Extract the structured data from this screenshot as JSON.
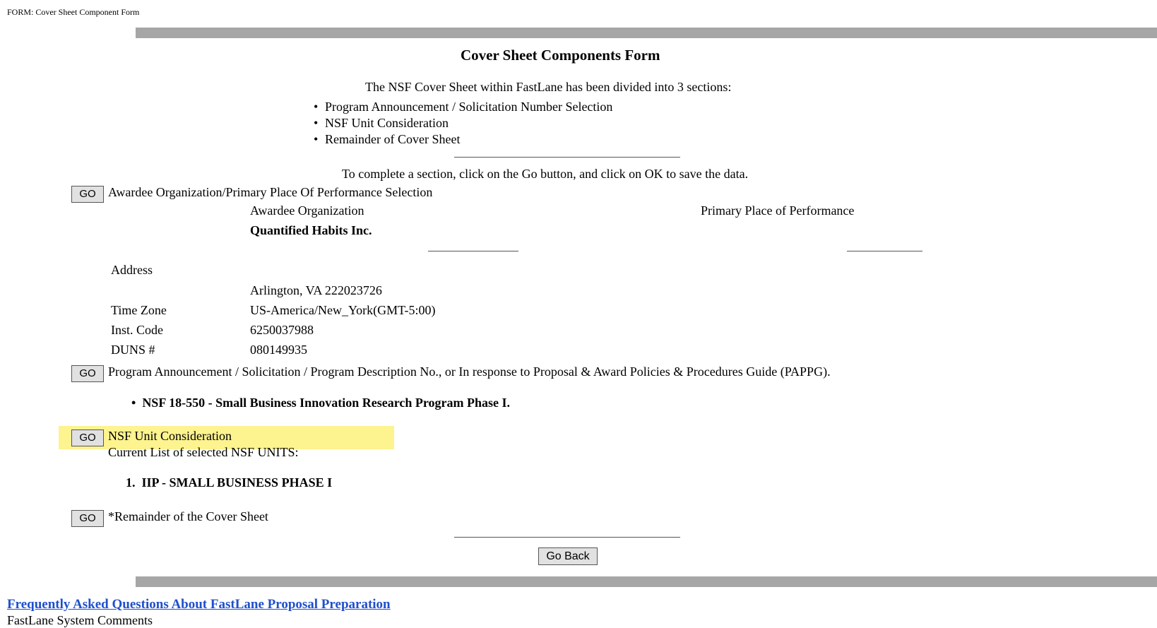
{
  "page": {
    "form_label": "FORM: Cover Sheet Component Form",
    "title": "Cover Sheet Components Form",
    "intro": "The NSF Cover Sheet within FastLane has been divided into 3 sections:",
    "sections": [
      "Program Announcement / Solicitation Number Selection",
      "NSF Unit Consideration",
      "Remainder of Cover Sheet"
    ],
    "instructions": "To complete a section, click on the Go button, and click on OK to save the data."
  },
  "go_label": "GO",
  "awardee": {
    "heading": "Awardee Organization/Primary Place Of Performance Selection",
    "org_label": "Awardee Organization",
    "ppop_label": "Primary Place of Performance",
    "org_name": "Quantified Habits Inc.",
    "address_label": "Address",
    "address_value": "Arlington, VA 222023726",
    "timezone_label": "Time Zone",
    "timezone_value": "US-America/New_York(GMT-5:00)",
    "inst_code_label": "Inst. Code",
    "inst_code_value": "6250037988",
    "duns_label": "DUNS #",
    "duns_value": "080149935"
  },
  "program": {
    "heading": "Program Announcement / Solicitation / Program Description No., or In response to Proposal & Award Policies & Procedures Guide (PAPPG).",
    "selected": "NSF 18-550 - Small Business Innovation Research Program Phase I."
  },
  "nsf_unit": {
    "heading": "NSF Unit Consideration",
    "list_label": "Current List of selected NSF UNITS:",
    "item_number": "1.",
    "item": "IIP - SMALL BUSINESS PHASE I"
  },
  "remainder": {
    "heading": "*Remainder of the Cover Sheet"
  },
  "go_back_label": "Go Back",
  "footer": {
    "faq_link": "Frequently Asked Questions About FastLane Proposal Preparation",
    "comments": "FastLane System Comments"
  },
  "colors": {
    "bar": "#a6a6a6",
    "highlight": "#fdf38f",
    "link": "#1f4fcc",
    "button": "#e1e1e1"
  }
}
